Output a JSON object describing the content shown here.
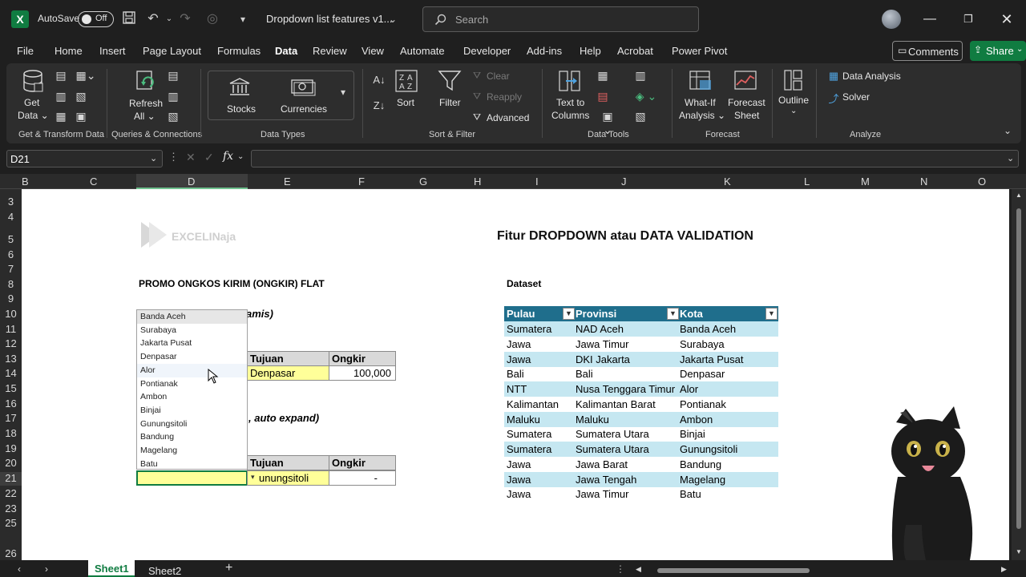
{
  "titlebar": {
    "autosave_label": "AutoSave",
    "autosave_state": "Off",
    "doc_title": "Dropdown list features v1...",
    "search_placeholder": "Search"
  },
  "menu": {
    "items": [
      "File",
      "Home",
      "Insert",
      "Page Layout",
      "Formulas",
      "Data",
      "Review",
      "View",
      "Automate",
      "Developer",
      "Add-ins",
      "Help",
      "Acrobat",
      "Power Pivot"
    ],
    "active": "Data",
    "comments_label": "Comments",
    "share_label": "Share"
  },
  "ribbon": {
    "get_data": "Get Data",
    "group_get_transform": "Get & Transform Data",
    "refresh_all": "Refresh All",
    "group_queries": "Queries & Connections",
    "stocks": "Stocks",
    "currencies": "Currencies",
    "group_data_types": "Data Types",
    "sort": "Sort",
    "filter": "Filter",
    "clear": "Clear",
    "reapply": "Reapply",
    "advanced": "Advanced",
    "group_sort_filter": "Sort & Filter",
    "text_to_columns": "Text to Columns",
    "group_data_tools": "Data Tools",
    "what_if": "What-If Analysis",
    "forecast_sheet": "Forecast Sheet",
    "group_forecast": "Forecast",
    "outline": "Outline",
    "data_analysis": "Data Analysis",
    "solver": "Solver",
    "group_analyze": "Analyze"
  },
  "formula_bar": {
    "name_box": "D21",
    "fx": "fx",
    "formula": ""
  },
  "grid": {
    "columns": [
      "B",
      "C",
      "D",
      "E",
      "F",
      "G",
      "H",
      "I",
      "J",
      "K",
      "L",
      "M",
      "N",
      "O"
    ],
    "rows": [
      "3",
      "4",
      "5",
      "6",
      "7",
      "8",
      "9",
      "10",
      "11",
      "12",
      "13",
      "14",
      "15",
      "16",
      "17",
      "18",
      "19",
      "20",
      "21",
      "22",
      "23",
      "25",
      "26"
    ]
  },
  "sheet": {
    "logo_text": "EXCELINaja",
    "main_title": "Fitur DROPDOWN atau DATA VALIDATION",
    "promo_title": "PROMO ONGKOS KIRIM (ONGKIR) FLAT",
    "note1_fragment": "amis)",
    "note2_fragment": ", auto expand)",
    "table1": {
      "tujuan_header": "Tujuan",
      "ongkir_header": "Ongkir",
      "tujuan_value": "Denpasar",
      "ongkir_value": "100,000"
    },
    "table2": {
      "tujuan_header": "Tujuan",
      "ongkir_header": "Ongkir",
      "tujuan_value": "unungsitoli",
      "ongkir_value": "-"
    },
    "dataset_label": "Dataset"
  },
  "dropdown": {
    "options": [
      "Banda Aceh",
      "Surabaya",
      "Jakarta Pusat",
      "Denpasar",
      "Alor",
      "Pontianak",
      "Ambon",
      "Binjai",
      "Gunungsitoli",
      "Bandung",
      "Magelang",
      "Batu"
    ],
    "highlighted": "Banda Aceh",
    "hovered": "Alor"
  },
  "dataset": {
    "headers": [
      "Pulau",
      "Provinsi",
      "Kota"
    ],
    "rows": [
      [
        "Sumatera",
        "NAD Aceh",
        "Banda Aceh"
      ],
      [
        "Jawa",
        "Jawa Timur",
        "Surabaya"
      ],
      [
        "Jawa",
        "DKI Jakarta",
        "Jakarta Pusat"
      ],
      [
        "Bali",
        "Bali",
        "Denpasar"
      ],
      [
        "NTT",
        "Nusa Tenggara Timur",
        "Alor"
      ],
      [
        "Kalimantan",
        "Kalimantan Barat",
        "Pontianak"
      ],
      [
        "Maluku",
        "Maluku",
        "Ambon"
      ],
      [
        "Sumatera",
        "Sumatera Utara",
        "Binjai"
      ],
      [
        "Sumatera",
        "Sumatera Utara",
        "Gunungsitoli"
      ],
      [
        "Jawa",
        "Jawa Barat",
        "Bandung"
      ],
      [
        "Jawa",
        "Jawa Tengah",
        "Magelang"
      ],
      [
        "Jawa",
        "Jawa Timur",
        "Batu"
      ]
    ]
  },
  "tabs": {
    "sheets": [
      "Sheet1",
      "Sheet2"
    ],
    "active": "Sheet1",
    "add": "+"
  },
  "colors": {
    "excel_green": "#107c41",
    "table_header": "#1f6e8c",
    "band": "#c5e7f1",
    "input_yellow": "#ffff99"
  }
}
